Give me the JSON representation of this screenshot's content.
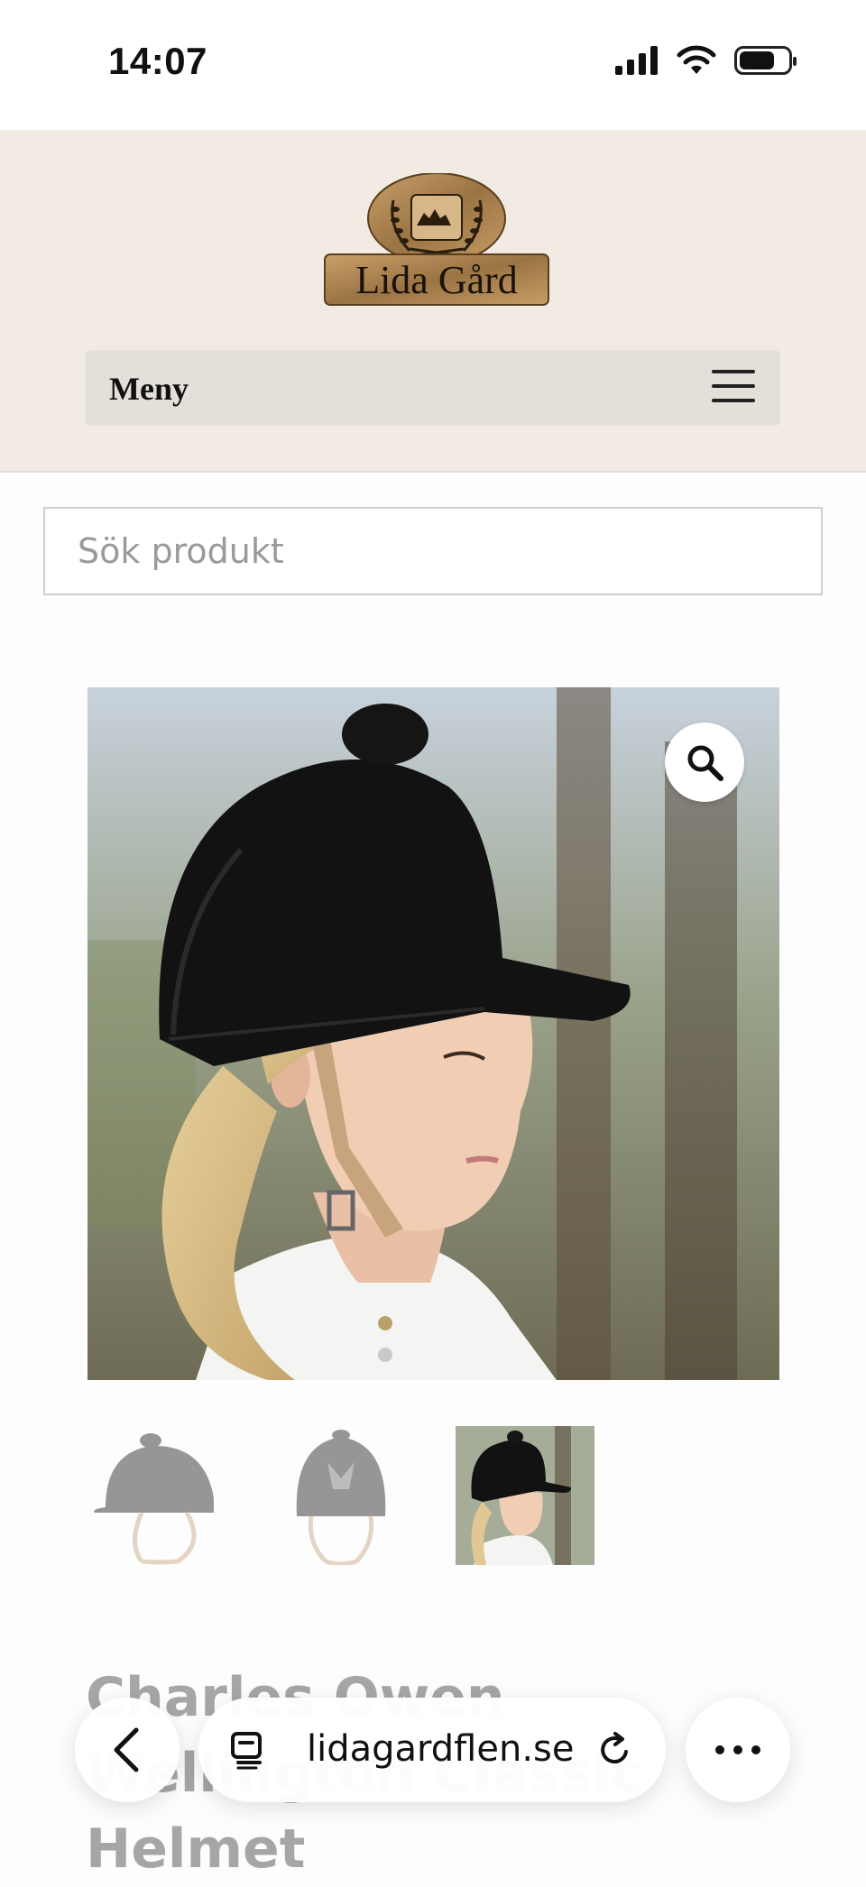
{
  "status_bar": {
    "time": "14:07",
    "icons": [
      "cellular-signal-icon",
      "wifi-icon",
      "battery-icon"
    ],
    "battery_level": 0.7
  },
  "header": {
    "logo_text": "Lida Gård",
    "menu_label": "Meny",
    "menu_icon": "hamburger-icon",
    "background": "#f1ebe4",
    "menu_bar_color": "#e4e0d9"
  },
  "search": {
    "placeholder": "Sök produkt",
    "value": ""
  },
  "product": {
    "title": "Charles Owen Wellington Classic Helmet",
    "zoom_icon": "magnifier-icon",
    "thumbnails": [
      {
        "name": "helmet-side",
        "selected": false
      },
      {
        "name": "helmet-back",
        "selected": false
      },
      {
        "name": "helmet-on-rider",
        "selected": true
      }
    ]
  },
  "browser_bar": {
    "url": "lidagardflen.se",
    "icons": [
      "back-chevron-icon",
      "tabs-icon",
      "reload-icon",
      "more-icon"
    ]
  },
  "colors": {
    "logo_gold": "#b48a52",
    "helmet": "#121212",
    "strap": "#c8a47e"
  }
}
